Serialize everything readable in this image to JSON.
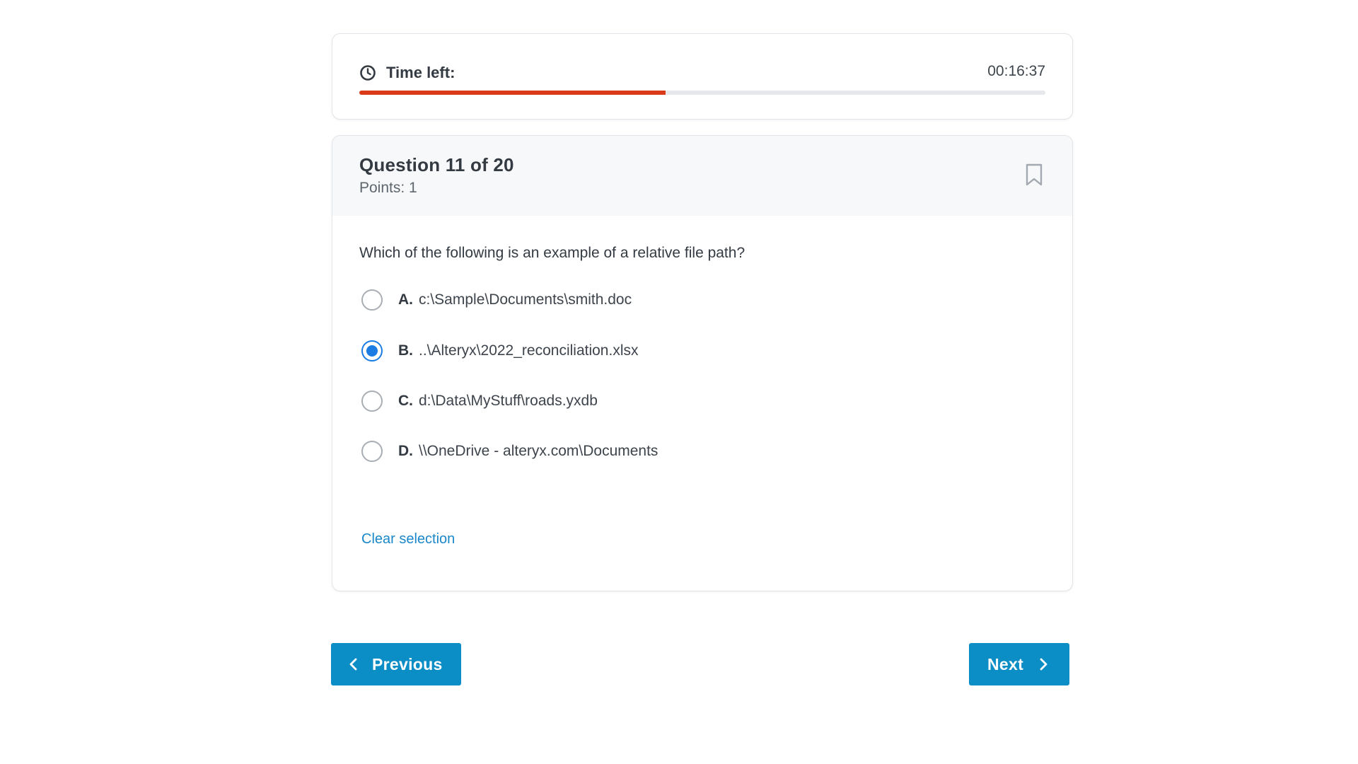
{
  "timer": {
    "label": "Time left:",
    "value": "00:16:37",
    "progress_fraction": 0.446,
    "progress_color": "#d93a17",
    "icon": "clock-icon"
  },
  "question": {
    "title": "Question 11 of 20",
    "points": "Points: 1",
    "text": "Which of the following is an example of a relative file path?",
    "bookmark_icon": "bookmark-icon",
    "options": [
      {
        "letter": "A.",
        "text": "c:\\Sample\\Documents\\smith.doc",
        "selected": false
      },
      {
        "letter": "B.",
        "text": "..\\Alteryx\\2022_reconciliation.xlsx",
        "selected": true
      },
      {
        "letter": "C.",
        "text": "d:\\Data\\MyStuff\\roads.yxdb",
        "selected": false
      },
      {
        "letter": "D.",
        "text": "\\\\OneDrive - alteryx.com\\Documents",
        "selected": false
      }
    ],
    "clear_label": "Clear selection"
  },
  "nav": {
    "previous_label": "Previous",
    "next_label": "Next"
  },
  "colors": {
    "accent": "#0b8dc6",
    "radio_selected": "#1b7de3",
    "link": "#1b87c9"
  }
}
